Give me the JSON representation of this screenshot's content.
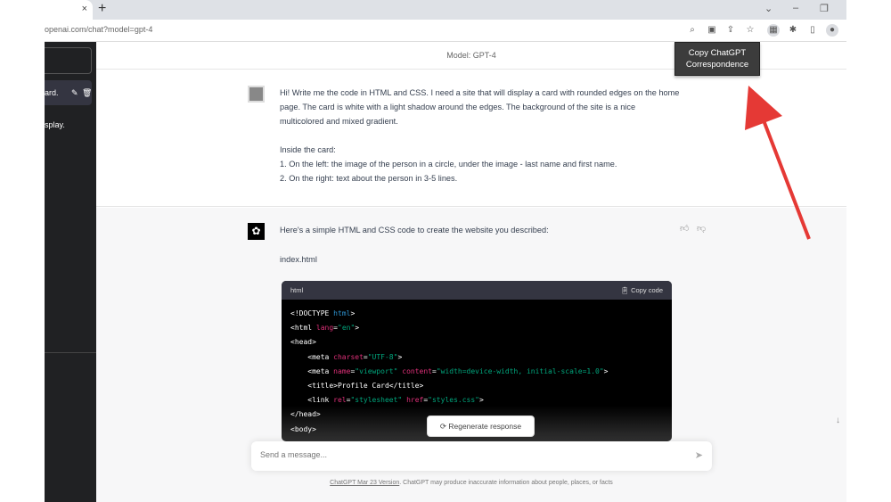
{
  "browser": {
    "url": "openai.com/chat?model=gpt-4",
    "tab_close": "×",
    "new_tab": "+"
  },
  "tooltip": "Copy ChatGPT Correspondence",
  "sidebar": {
    "item1": "ard.",
    "item2": "splay."
  },
  "header": {
    "model": "Model: GPT-4"
  },
  "user_message": [
    "Hi! Write me the code in HTML and CSS. I need a site that will display a card with rounded edges on the home page. The card is white with a light shadow around the edges. The background of the site is a nice multicolored and mixed gradient.",
    "",
    "Inside the card:",
    "1. On the left: the image of the person in a circle, under the image - last name and first name.",
    "2. On the right: text about the person in 3-5 lines."
  ],
  "assistant": {
    "intro": "Here's a simple HTML and CSS code to create the website you described:",
    "filename": "index.html"
  },
  "code": {
    "lang": "html",
    "copy_label": "Copy code"
  },
  "buttons": {
    "regenerate": "Regenerate response"
  },
  "input": {
    "placeholder": "Send a message..."
  },
  "footer": {
    "link": "ChatGPT Mar 23 Version",
    "text": ". ChatGPT may produce inaccurate information about people, places, or facts"
  },
  "colors": {
    "arrow": "#e53935",
    "sidebar": "#202123"
  }
}
